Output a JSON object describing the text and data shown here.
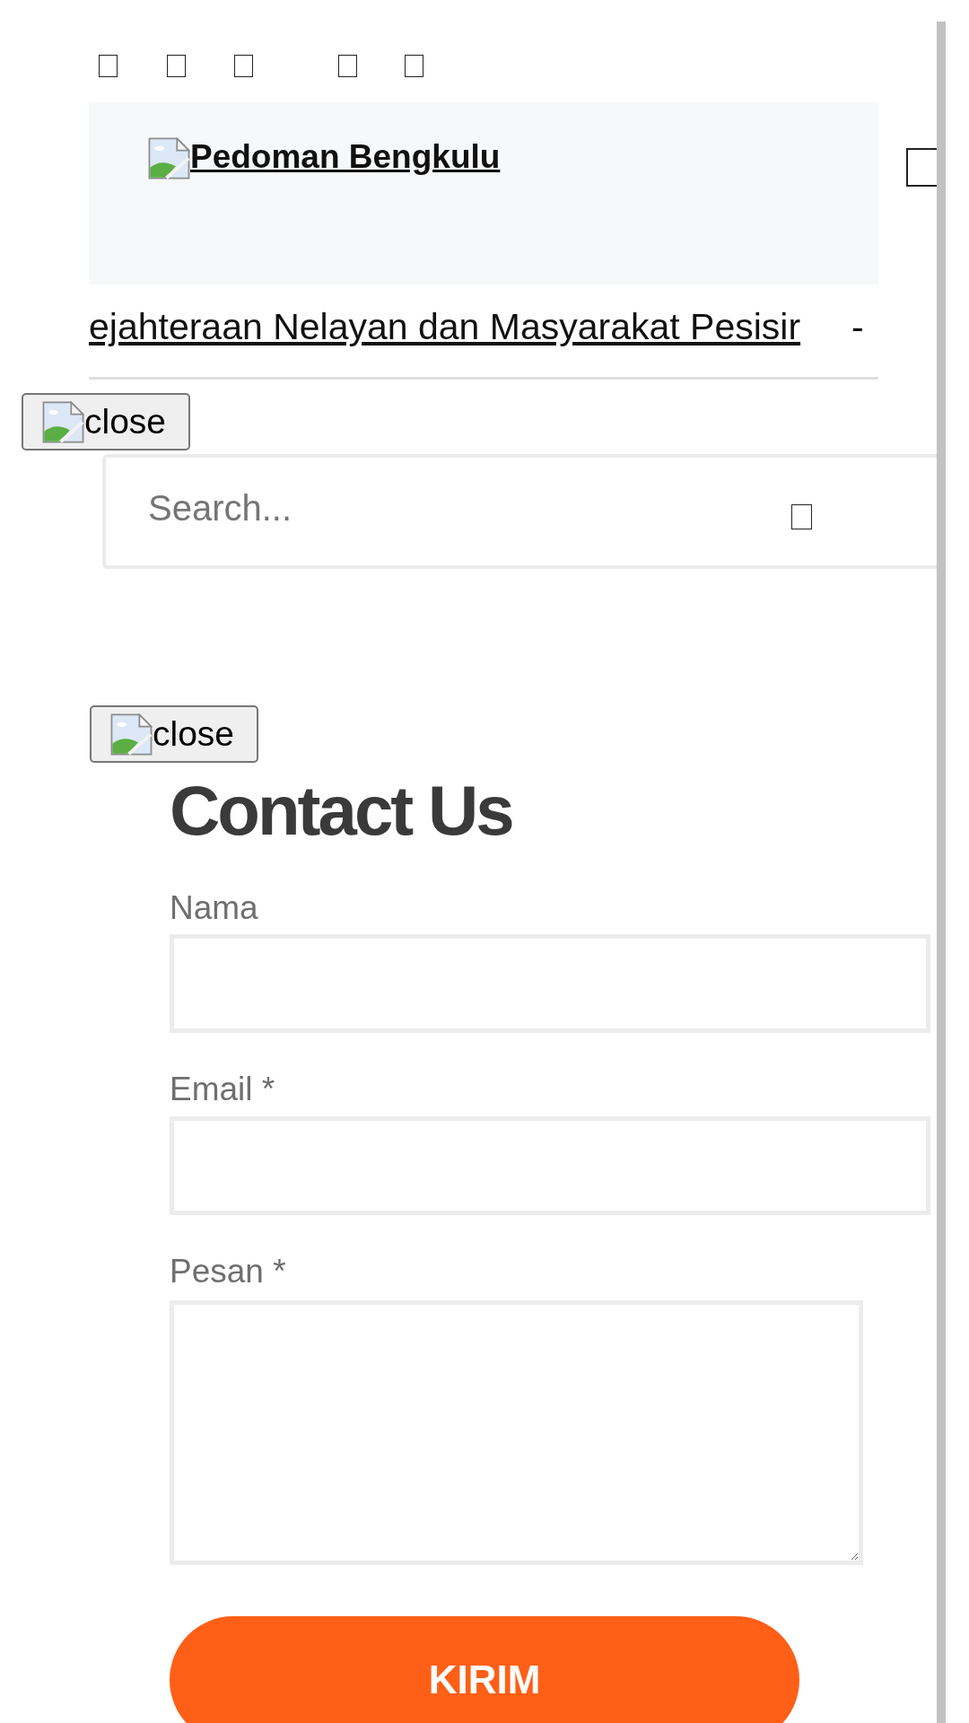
{
  "header": {
    "logo_text": "Pedoman Bengkulu"
  },
  "ticker": {
    "headline": "ejahteraan Nelayan dan Masyarakat Pesisir",
    "separator": "-"
  },
  "menu_close_button": {
    "label": "close"
  },
  "search": {
    "placeholder": "Search..."
  },
  "popup_close_button": {
    "label": "close"
  },
  "contact_form": {
    "title": "Contact Us",
    "fields": [
      {
        "kind": "text",
        "label": "Nama"
      },
      {
        "kind": "text",
        "label": "Email *"
      },
      {
        "kind": "textarea",
        "label": "Pesan *"
      }
    ],
    "submit": "KIRIM"
  }
}
